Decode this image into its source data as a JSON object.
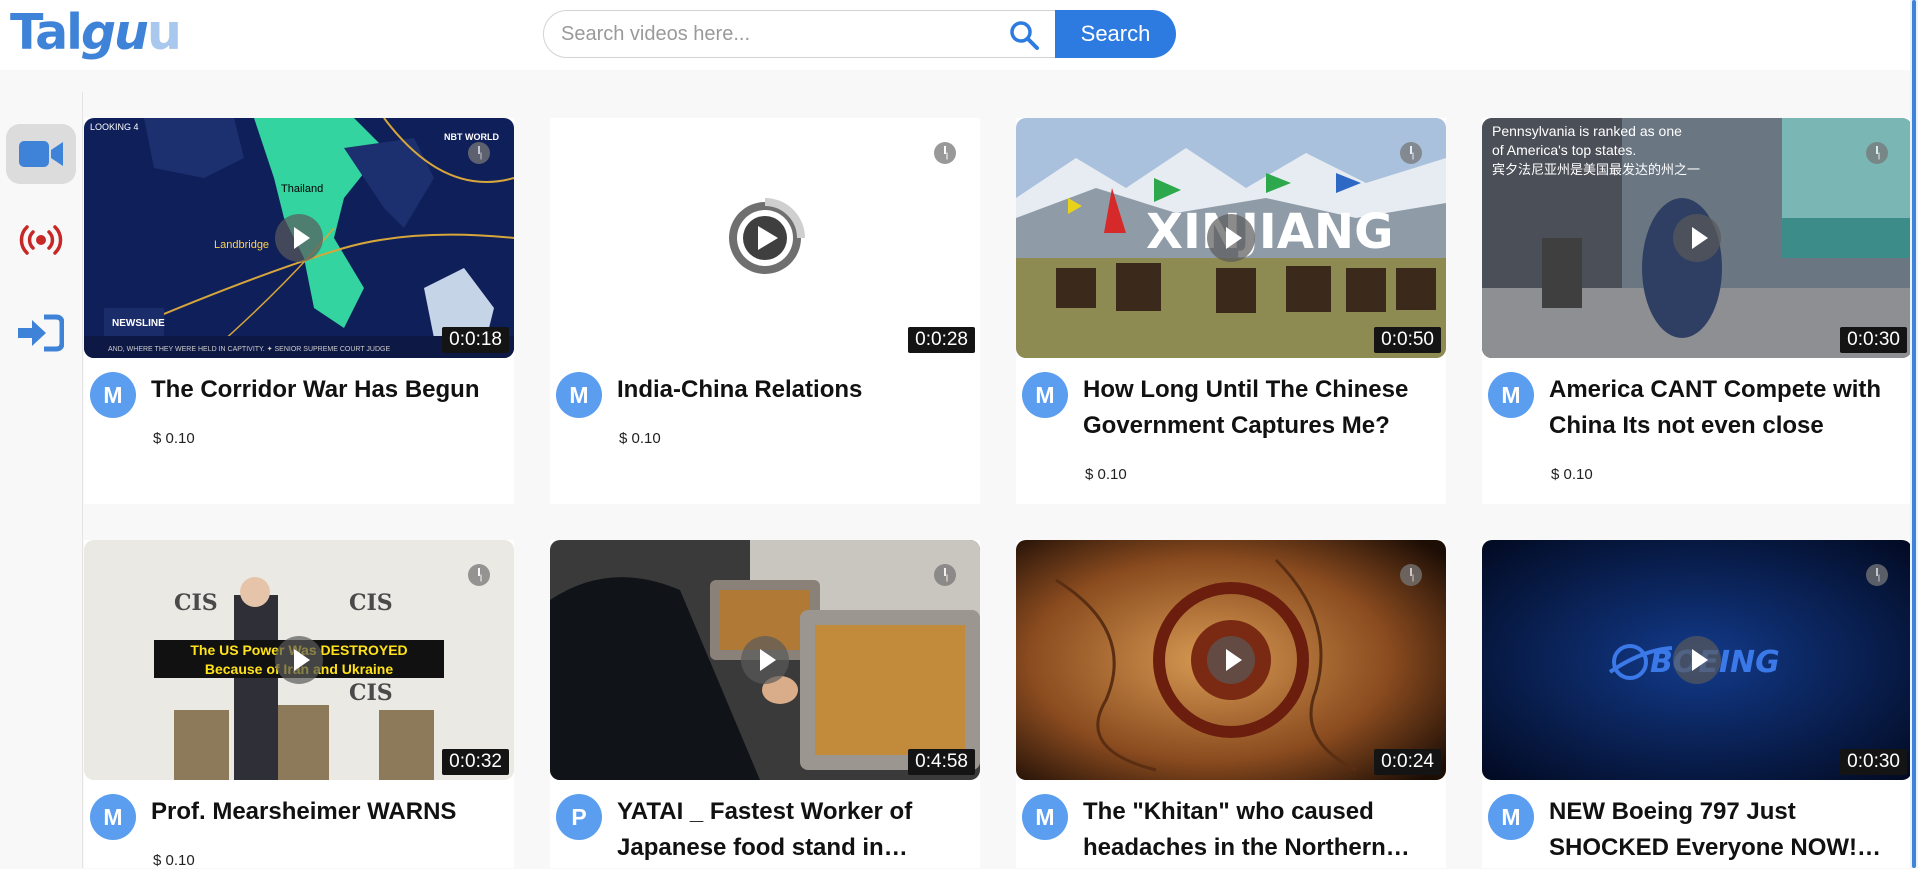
{
  "app": {
    "logo_main": "Tal",
    "logo_gu": "gu",
    "logo_u": "u"
  },
  "search": {
    "placeholder": "Search videos here...",
    "button_label": "Search"
  },
  "sidebar": {
    "items": [
      {
        "icon": "video-camera-icon",
        "active": true
      },
      {
        "icon": "live-broadcast-icon",
        "active": false
      },
      {
        "icon": "login-icon",
        "active": false
      }
    ]
  },
  "colors": {
    "brand": "#3f83d8",
    "search_button": "#2d7be0",
    "avatar": "#5b9ef0",
    "live_icon": "#c62828"
  },
  "videos": [
    {
      "avatar": "M",
      "title": "The Corridor War Has Begun",
      "price": "$ 0.10",
      "duration": "0:0:18",
      "overlay": {
        "top_left": "LOOKING 4",
        "country": "Thailand",
        "route": "Landbridge",
        "ticker": "NEWSLINE",
        "ticker_text": "AND, WHERE THEY WERE HELD IN CAPTIVITY. ✦ SENIOR SUPREME COURT JUDGE",
        "channel": "NBT WORLD"
      }
    },
    {
      "avatar": "M",
      "title": "India-China Relations",
      "price": "$ 0.10",
      "duration": "0:0:28"
    },
    {
      "avatar": "M",
      "title": "How Long Until The Chinese Government Captures Me?",
      "price": "$ 0.10",
      "duration": "0:0:50",
      "overlay": {
        "caption": "XINJIANG"
      }
    },
    {
      "avatar": "M",
      "title": "America CANT Compete with China Its not even close",
      "price": "$ 0.10",
      "duration": "0:0:30",
      "overlay": {
        "caption_line1": "Pennsylvania is ranked as one",
        "caption_line2": "of America's top states.",
        "caption_line3": "宾夕法尼亚州是美国最发达的州之一"
      }
    },
    {
      "avatar": "M",
      "title": "Prof. Mearsheimer WARNS",
      "price": "$ 0.10",
      "duration": "0:0:32",
      "overlay": {
        "banner1": "The US Power Was DESTROYED",
        "banner2": "Because of Iran and Ukraine",
        "logo": "CIS"
      }
    },
    {
      "avatar": "P",
      "title": "YATAI _ Fastest Worker of Japanese food stand in…",
      "duration": "0:4:58"
    },
    {
      "avatar": "M",
      "title": "The \"Khitan\" who caused headaches in the Northern…",
      "duration": "0:0:24"
    },
    {
      "avatar": "M",
      "title": "NEW Boeing 797 Just SHOCKED Everyone NOW!…",
      "duration": "0:0:30",
      "overlay": {
        "logo": "BOEING"
      }
    }
  ]
}
